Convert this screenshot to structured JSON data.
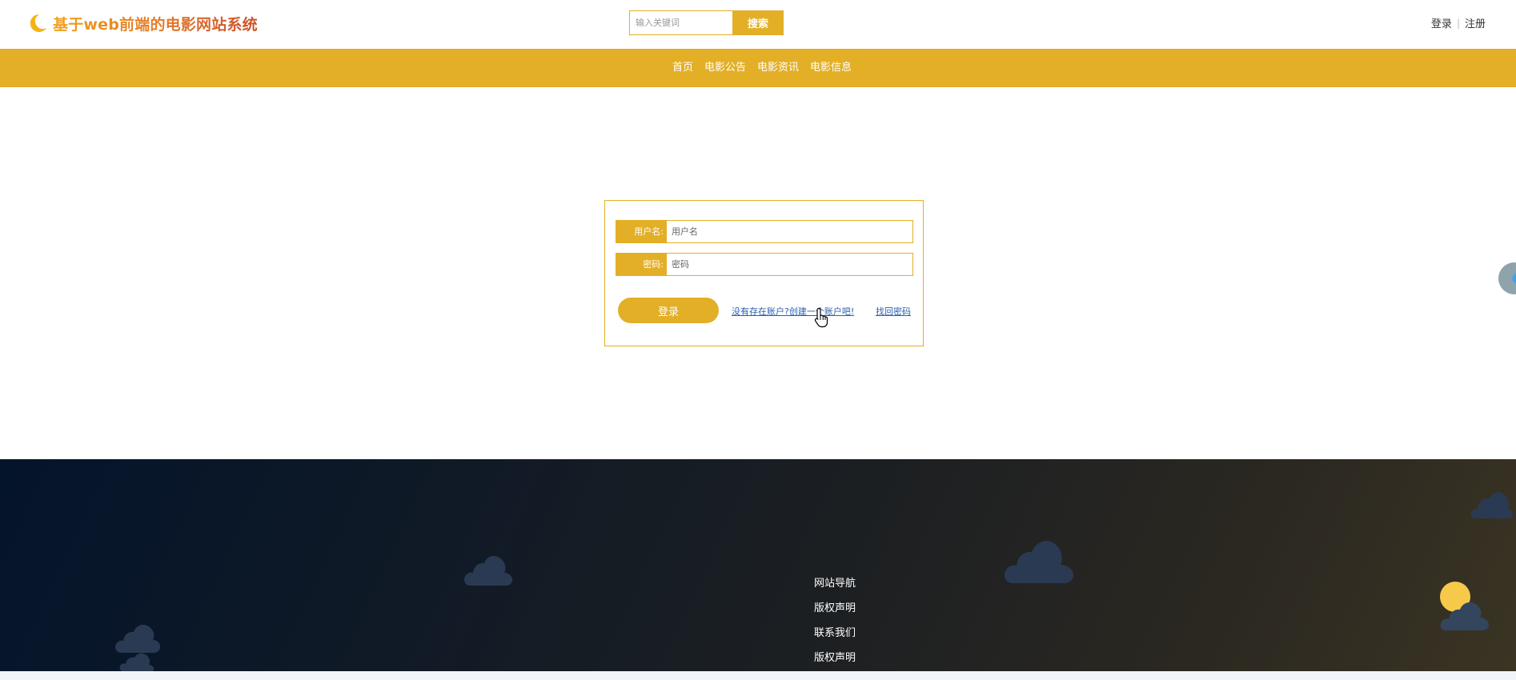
{
  "header": {
    "site_title": "基于web前端的电影网站系统",
    "search": {
      "placeholder": "输入关键词",
      "button_label": "搜索"
    },
    "auth": {
      "login_label": "登录",
      "separator": "|",
      "register_label": "注册"
    }
  },
  "nav": {
    "items": [
      {
        "label": "首页"
      },
      {
        "label": "电影公告"
      },
      {
        "label": "电影资讯"
      },
      {
        "label": "电影信息"
      }
    ]
  },
  "login_form": {
    "username": {
      "label": "用户名:",
      "placeholder": "用户名"
    },
    "password": {
      "label": "密码:",
      "placeholder": "密码"
    },
    "submit_label": "登录",
    "register_link": "没有存在账户?创建一个账户吧!",
    "forgot_link": "找回密码"
  },
  "footer": {
    "links": [
      {
        "label": "网站导航"
      },
      {
        "label": "版权声明"
      },
      {
        "label": "联系我们"
      },
      {
        "label": "版权声明"
      }
    ]
  },
  "colors": {
    "accent": "#e3af26",
    "link": "#2b5fae",
    "footer_dark": "#04142b",
    "footer_warm": "#3a3423",
    "cloud": "#2a3a52",
    "sun": "#f7c94b"
  },
  "icons": {
    "logo": "crescent-moon-icon",
    "cursor": "hand-pointer-icon",
    "weather": "sun-behind-cloud-icon"
  }
}
